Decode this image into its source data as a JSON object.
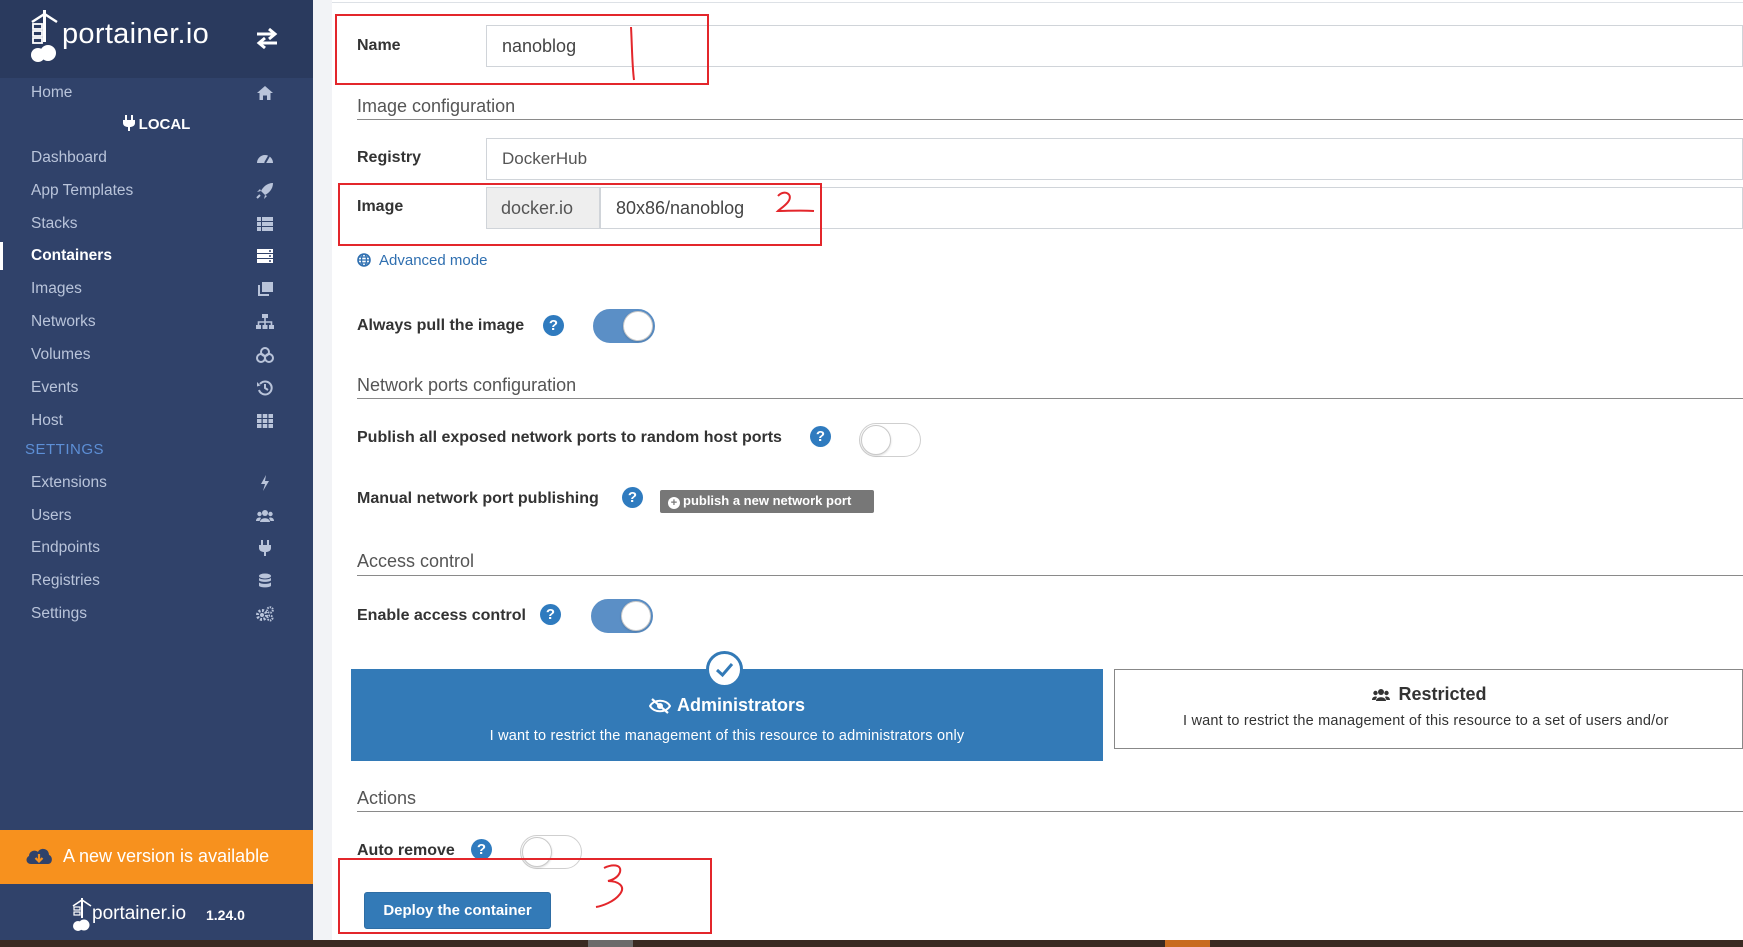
{
  "sidebar": {
    "brand": "portainer.io",
    "nav_top": [
      {
        "label": "Home",
        "icon": "home-icon"
      }
    ],
    "environment": "LOCAL",
    "nav_items": [
      {
        "label": "Dashboard",
        "icon": "dashboard-icon"
      },
      {
        "label": "App Templates",
        "icon": "rocket-icon"
      },
      {
        "label": "Stacks",
        "icon": "th-list-icon"
      },
      {
        "label": "Containers",
        "icon": "server-icon",
        "active": true
      },
      {
        "label": "Images",
        "icon": "clone-icon"
      },
      {
        "label": "Networks",
        "icon": "sitemap-icon"
      },
      {
        "label": "Volumes",
        "icon": "cubes-icon"
      },
      {
        "label": "Events",
        "icon": "history-icon"
      },
      {
        "label": "Host",
        "icon": "th-icon"
      }
    ],
    "settings_label": "SETTINGS",
    "settings_items": [
      {
        "label": "Extensions",
        "icon": "bolt-icon"
      },
      {
        "label": "Users",
        "icon": "users-icon"
      },
      {
        "label": "Endpoints",
        "icon": "plug-icon"
      },
      {
        "label": "Registries",
        "icon": "database-icon"
      },
      {
        "label": "Settings",
        "icon": "cogs-icon"
      }
    ],
    "update_banner": "A new version is available",
    "footer_brand": "portainer.io",
    "version": "1.24.0"
  },
  "form": {
    "name_label": "Name",
    "name_value": "nanoblog",
    "image_config_title": "Image configuration",
    "registry_label": "Registry",
    "registry_value": "DockerHub",
    "image_label": "Image",
    "image_prefix": "docker.io",
    "image_value": "80x86/nanoblog",
    "advanced_mode": "Advanced mode",
    "always_pull_label": "Always pull the image",
    "always_pull_on": true,
    "network_title": "Network ports configuration",
    "publish_all_label": "Publish all exposed network ports to random host ports",
    "publish_all_on": false,
    "manual_publish_label": "Manual network port publishing",
    "publish_button": "publish a new network port",
    "access_title": "Access control",
    "enable_access_label": "Enable access control",
    "enable_access_on": true,
    "admin_title": "Administrators",
    "admin_desc": "I want to restrict the management of this resource to administrators only",
    "restricted_title": "Restricted",
    "restricted_desc": "I want to restrict the management of this resource to a set of users and/or",
    "actions_title": "Actions",
    "auto_remove_label": "Auto remove",
    "auto_remove_on": false,
    "deploy_button": "Deploy the container",
    "help_glyph": "?"
  },
  "annotations": {
    "mark_1": "1",
    "mark_2": "2",
    "mark_3": "3",
    "color": "#e3262b"
  },
  "colors": {
    "sidebar": "#30426a",
    "primary": "#337ab7",
    "banner": "#f7911e"
  }
}
